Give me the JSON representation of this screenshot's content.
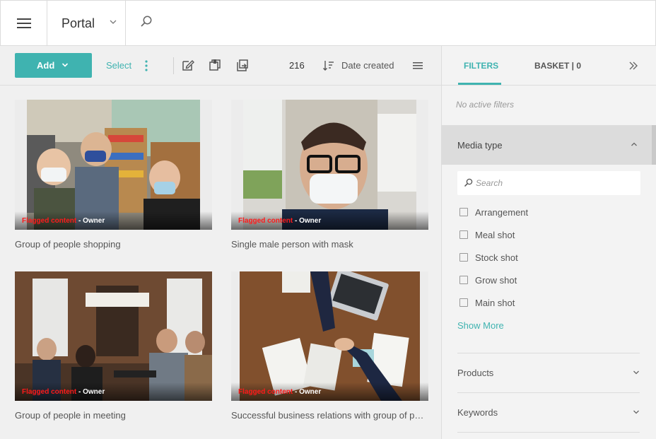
{
  "header": {
    "portal_title": "Portal"
  },
  "toolbar": {
    "add_label": "Add",
    "select_label": "Select",
    "count": "216",
    "sort_label": "Date created"
  },
  "cards": [
    {
      "title": "Group of people shopping",
      "flag": "Flagged content",
      "sep": " - ",
      "owner": "Owner"
    },
    {
      "title": "Single male person with mask",
      "flag": "Flagged content",
      "sep": " - ",
      "owner": "Owner"
    },
    {
      "title": "Group of people in meeting",
      "flag": "Flagged content",
      "sep": " - ",
      "owner": "Owner"
    },
    {
      "title": "Successful business relations with group of people",
      "flag": "Flagged content",
      "sep": " - ",
      "owner": "Owner"
    }
  ],
  "panel": {
    "tabs": {
      "filters": "FILTERS",
      "basket": "BASKET | 0"
    },
    "no_filters": "No active filters",
    "media_type": {
      "title": "Media type",
      "search_placeholder": "Search",
      "options": [
        "Arrangement",
        "Meal shot",
        "Stock shot",
        "Grow shot",
        "Main shot"
      ],
      "show_more": "Show More"
    },
    "sections": [
      "Products",
      "Keywords"
    ]
  },
  "colors": {
    "accent": "#3fb3b0",
    "flag_red": "#ff1a1a"
  }
}
